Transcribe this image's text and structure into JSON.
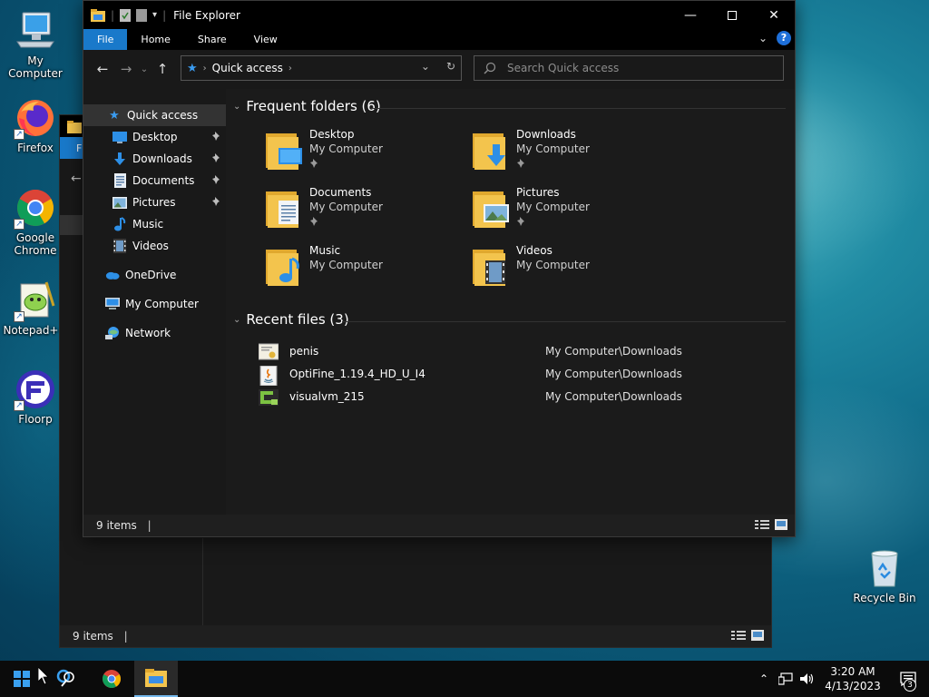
{
  "desktop": {
    "icons": [
      {
        "label": "My Computer"
      },
      {
        "label": "Firefox"
      },
      {
        "label": "Google Chrome"
      },
      {
        "label": "Notepad++"
      },
      {
        "label": "Floorp"
      },
      {
        "label": "Recycle Bin"
      }
    ]
  },
  "back_window": {
    "status_items": "9 items"
  },
  "window": {
    "title": "File Explorer",
    "ribbon_tabs": [
      "File",
      "Home",
      "Share",
      "View"
    ],
    "address": {
      "path_item": "Quick access"
    },
    "search": {
      "placeholder": "Search Quick access"
    },
    "nav_pane": {
      "quick_access": "Quick access",
      "pinned": [
        "Desktop",
        "Downloads",
        "Documents",
        "Pictures"
      ],
      "unpinned": [
        "Music",
        "Videos"
      ],
      "onedrive": "OneDrive",
      "my_computer": "My Computer",
      "network": "Network"
    },
    "frequent": {
      "header": "Frequent folders (6)",
      "folders": [
        {
          "name": "Desktop",
          "location": "My Computer",
          "pinned": true
        },
        {
          "name": "Downloads",
          "location": "My Computer",
          "pinned": true
        },
        {
          "name": "Documents",
          "location": "My Computer",
          "pinned": true
        },
        {
          "name": "Pictures",
          "location": "My Computer",
          "pinned": true
        },
        {
          "name": "Music",
          "location": "My Computer",
          "pinned": false
        },
        {
          "name": "Videos",
          "location": "My Computer",
          "pinned": false
        }
      ]
    },
    "recent": {
      "header": "Recent files (3)",
      "files": [
        {
          "name": "penis",
          "path": "My Computer\\Downloads"
        },
        {
          "name": "OptiFine_1.19.4_HD_U_I4",
          "path": "My Computer\\Downloads"
        },
        {
          "name": "visualvm_215",
          "path": "My Computer\\Downloads"
        }
      ]
    },
    "status_items": "9 items"
  },
  "taskbar": {
    "time": "3:20 AM",
    "date": "4/13/2023",
    "notification_count": "3"
  },
  "colors": {
    "accent": "#1979ca",
    "folder_yellow": "#f3c44d",
    "taskbar": "#0b0b0b"
  }
}
